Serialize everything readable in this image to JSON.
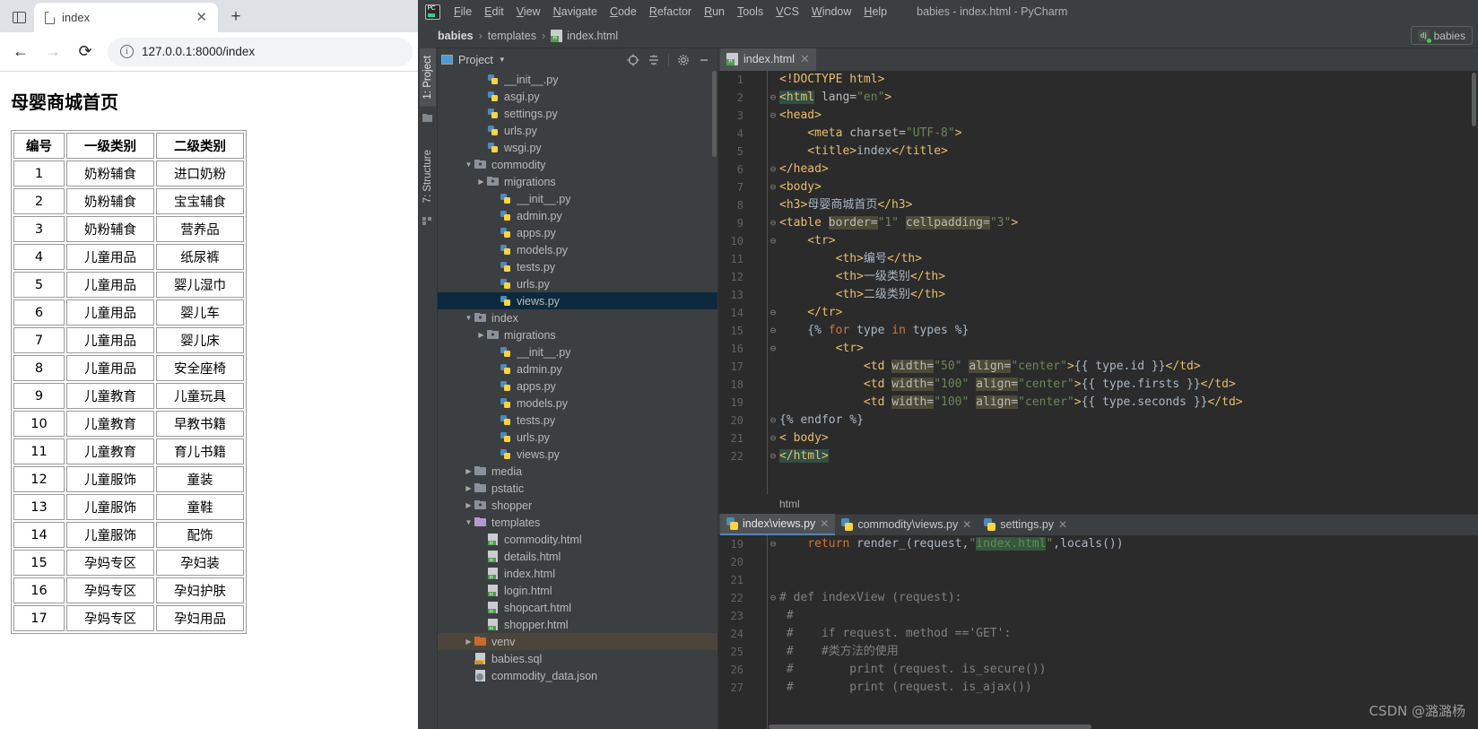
{
  "browser": {
    "tab": {
      "title": "index",
      "close_label": "✕"
    },
    "new_tab_label": "+",
    "nav": {
      "back": "←",
      "forward": "→",
      "reload": "⟳",
      "info": "i"
    },
    "address": "127.0.0.1:8000/index",
    "page": {
      "heading": "母婴商城首页",
      "table": {
        "headers": [
          "编号",
          "一级类别",
          "二级类别"
        ],
        "rows": [
          [
            "1",
            "奶粉辅食",
            "进口奶粉"
          ],
          [
            "2",
            "奶粉辅食",
            "宝宝辅食"
          ],
          [
            "3",
            "奶粉辅食",
            "营养品"
          ],
          [
            "4",
            "儿童用品",
            "纸尿裤"
          ],
          [
            "5",
            "儿童用品",
            "婴儿湿巾"
          ],
          [
            "6",
            "儿童用品",
            "婴儿车"
          ],
          [
            "7",
            "儿童用品",
            "婴儿床"
          ],
          [
            "8",
            "儿童用品",
            "安全座椅"
          ],
          [
            "9",
            "儿童教育",
            "儿童玩具"
          ],
          [
            "10",
            "儿童教育",
            "早教书籍"
          ],
          [
            "11",
            "儿童教育",
            "育儿书籍"
          ],
          [
            "12",
            "儿童服饰",
            "童装"
          ],
          [
            "13",
            "儿童服饰",
            "童鞋"
          ],
          [
            "14",
            "儿童服饰",
            "配饰"
          ],
          [
            "15",
            "孕妈专区",
            "孕妇装"
          ],
          [
            "16",
            "孕妈专区",
            "孕妇护肤"
          ],
          [
            "17",
            "孕妈专区",
            "孕妇用品"
          ]
        ]
      }
    }
  },
  "pycharm": {
    "menu": [
      "File",
      "Edit",
      "View",
      "Navigate",
      "Code",
      "Refactor",
      "Run",
      "Tools",
      "VCS",
      "Window",
      "Help"
    ],
    "window_title": "babies - index.html - PyCharm",
    "breadcrumb": [
      "babies",
      "templates",
      "index.html"
    ],
    "run_config": "babies",
    "tool_tabs": [
      "1: Project",
      "7: Structure"
    ],
    "project": {
      "title": "Project",
      "icons": [
        "locate-icon",
        "collapse-all-icon",
        "gear-icon",
        "minimize-icon"
      ],
      "tree": [
        {
          "indent": 3,
          "label": "__init__.py",
          "icon": "python-file-icon",
          "arrow": ""
        },
        {
          "indent": 3,
          "label": "asgi.py",
          "icon": "python-file-icon",
          "arrow": ""
        },
        {
          "indent": 3,
          "label": "settings.py",
          "icon": "python-file-icon",
          "arrow": ""
        },
        {
          "indent": 3,
          "label": "urls.py",
          "icon": "python-file-icon",
          "arrow": ""
        },
        {
          "indent": 3,
          "label": "wsgi.py",
          "icon": "python-file-icon",
          "arrow": ""
        },
        {
          "indent": 2,
          "label": "commodity",
          "icon": "module-folder-icon",
          "arrow": "▼"
        },
        {
          "indent": 3,
          "label": "migrations",
          "icon": "module-folder-icon",
          "arrow": "▶"
        },
        {
          "indent": 4,
          "label": "__init__.py",
          "icon": "python-file-icon",
          "arrow": ""
        },
        {
          "indent": 4,
          "label": "admin.py",
          "icon": "python-file-icon",
          "arrow": ""
        },
        {
          "indent": 4,
          "label": "apps.py",
          "icon": "python-file-icon",
          "arrow": ""
        },
        {
          "indent": 4,
          "label": "models.py",
          "icon": "python-file-icon",
          "arrow": ""
        },
        {
          "indent": 4,
          "label": "tests.py",
          "icon": "python-file-icon",
          "arrow": ""
        },
        {
          "indent": 4,
          "label": "urls.py",
          "icon": "python-file-icon",
          "arrow": ""
        },
        {
          "indent": 4,
          "label": "views.py",
          "icon": "python-file-icon",
          "arrow": "",
          "state": "selected"
        },
        {
          "indent": 2,
          "label": "index",
          "icon": "module-folder-icon",
          "arrow": "▼"
        },
        {
          "indent": 3,
          "label": "migrations",
          "icon": "module-folder-icon",
          "arrow": "▶"
        },
        {
          "indent": 4,
          "label": "__init__.py",
          "icon": "python-file-icon",
          "arrow": ""
        },
        {
          "indent": 4,
          "label": "admin.py",
          "icon": "python-file-icon",
          "arrow": ""
        },
        {
          "indent": 4,
          "label": "apps.py",
          "icon": "python-file-icon",
          "arrow": ""
        },
        {
          "indent": 4,
          "label": "models.py",
          "icon": "python-file-icon",
          "arrow": ""
        },
        {
          "indent": 4,
          "label": "tests.py",
          "icon": "python-file-icon",
          "arrow": ""
        },
        {
          "indent": 4,
          "label": "urls.py",
          "icon": "python-file-icon",
          "arrow": ""
        },
        {
          "indent": 4,
          "label": "views.py",
          "icon": "python-file-icon",
          "arrow": ""
        },
        {
          "indent": 2,
          "label": "media",
          "icon": "folder-icon",
          "arrow": "▶"
        },
        {
          "indent": 2,
          "label": "pstatic",
          "icon": "folder-icon",
          "arrow": "▶"
        },
        {
          "indent": 2,
          "label": "shopper",
          "icon": "module-folder-icon",
          "arrow": "▶"
        },
        {
          "indent": 2,
          "label": "templates",
          "icon": "templates-folder-icon",
          "arrow": "▼"
        },
        {
          "indent": 3,
          "label": "commodity.html",
          "icon": "html-file-icon",
          "arrow": ""
        },
        {
          "indent": 3,
          "label": "details.html",
          "icon": "html-file-icon",
          "arrow": ""
        },
        {
          "indent": 3,
          "label": "index.html",
          "icon": "html-file-icon",
          "arrow": ""
        },
        {
          "indent": 3,
          "label": "login.html",
          "icon": "html-file-icon",
          "arrow": ""
        },
        {
          "indent": 3,
          "label": "shopcart.html",
          "icon": "html-file-icon",
          "arrow": ""
        },
        {
          "indent": 3,
          "label": "shopper.html",
          "icon": "html-file-icon",
          "arrow": ""
        },
        {
          "indent": 2,
          "label": "venv",
          "icon": "venv-folder-icon",
          "arrow": "▶",
          "state": "highlighted"
        },
        {
          "indent": 2,
          "label": "babies.sql",
          "icon": "sql-file-icon",
          "arrow": ""
        },
        {
          "indent": 2,
          "label": "commodity_data.json",
          "icon": "json-file-icon",
          "arrow": ""
        }
      ]
    },
    "editor": {
      "tab": {
        "label": "index.html",
        "close": "✕"
      },
      "breadcrumb": "html",
      "lines": [
        {
          "n": "1",
          "indent": 0,
          "fold": "",
          "parts": [
            {
              "t": "<!DOCTYPE html>",
              "c": "tag"
            }
          ]
        },
        {
          "n": "2",
          "indent": 0,
          "fold": "⊖",
          "parts": [
            {
              "t": "<html",
              "c": "tag hlteal"
            },
            {
              "t": " lang=",
              "c": "attr"
            },
            {
              "t": "\"en\"",
              "c": "val"
            },
            {
              "t": ">",
              "c": "tag"
            }
          ]
        },
        {
          "n": "3",
          "indent": 0,
          "fold": "⊖",
          "parts": [
            {
              "t": "<head>",
              "c": "tag"
            }
          ]
        },
        {
          "n": "4",
          "indent": 0,
          "fold": "",
          "parts": [
            {
              "t": "    <meta ",
              "c": "tag"
            },
            {
              "t": "charset=",
              "c": "attr"
            },
            {
              "t": "\"UTF-8\"",
              "c": "val"
            },
            {
              "t": ">",
              "c": "tag"
            }
          ]
        },
        {
          "n": "5",
          "indent": 0,
          "fold": "",
          "parts": [
            {
              "t": "    <title>",
              "c": "tag"
            },
            {
              "t": "index",
              "c": "txt"
            },
            {
              "t": "</title>",
              "c": "tag"
            }
          ]
        },
        {
          "n": "6",
          "indent": 0,
          "fold": "⊖",
          "parts": [
            {
              "t": "</head>",
              "c": "tag"
            }
          ]
        },
        {
          "n": "7",
          "indent": 0,
          "fold": "⊖",
          "parts": [
            {
              "t": "<body>",
              "c": "tag"
            }
          ]
        },
        {
          "n": "8",
          "indent": 0,
          "fold": "",
          "parts": [
            {
              "t": "<h3>",
              "c": "tag"
            },
            {
              "t": "母婴商城首页",
              "c": "txt"
            },
            {
              "t": "</h3>",
              "c": "tag"
            }
          ]
        },
        {
          "n": "9",
          "indent": 0,
          "fold": "⊖",
          "parts": [
            {
              "t": "<table ",
              "c": "tag"
            },
            {
              "t": "border=",
              "c": "attr hl"
            },
            {
              "t": "\"1\"",
              "c": "val"
            },
            {
              "t": " ",
              "c": "txt"
            },
            {
              "t": "cellpadding=",
              "c": "attr hl"
            },
            {
              "t": "\"3\"",
              "c": "val"
            },
            {
              "t": ">",
              "c": "tag"
            }
          ]
        },
        {
          "n": "10",
          "indent": 0,
          "fold": "⊖",
          "parts": [
            {
              "t": "    <tr>",
              "c": "tag"
            }
          ]
        },
        {
          "n": "11",
          "indent": 0,
          "fold": "",
          "parts": [
            {
              "t": "        <th>",
              "c": "tag"
            },
            {
              "t": "编号",
              "c": "txt"
            },
            {
              "t": "</th>",
              "c": "tag"
            }
          ]
        },
        {
          "n": "12",
          "indent": 0,
          "fold": "",
          "parts": [
            {
              "t": "        <th>",
              "c": "tag"
            },
            {
              "t": "一级类别",
              "c": "txt"
            },
            {
              "t": "</th>",
              "c": "tag"
            }
          ]
        },
        {
          "n": "13",
          "indent": 0,
          "fold": "",
          "parts": [
            {
              "t": "        <th>",
              "c": "tag"
            },
            {
              "t": "二级类别",
              "c": "txt"
            },
            {
              "t": "</th>",
              "c": "tag"
            }
          ]
        },
        {
          "n": "14",
          "indent": 0,
          "fold": "⊖",
          "parts": [
            {
              "t": "    </tr>",
              "c": "tag"
            }
          ]
        },
        {
          "n": "15",
          "indent": 0,
          "fold": "⊖",
          "parts": [
            {
              "t": "    {% ",
              "c": "txt"
            },
            {
              "t": "for",
              "c": "kw"
            },
            {
              "t": " type ",
              "c": "txt"
            },
            {
              "t": "in",
              "c": "kw"
            },
            {
              "t": " types %}",
              "c": "txt"
            }
          ]
        },
        {
          "n": "16",
          "indent": 0,
          "fold": "⊖",
          "parts": [
            {
              "t": "        <tr>",
              "c": "tag"
            }
          ]
        },
        {
          "n": "17",
          "indent": 0,
          "fold": "",
          "parts": [
            {
              "t": "            <td ",
              "c": "tag"
            },
            {
              "t": "width=",
              "c": "attr hl"
            },
            {
              "t": "\"50\"",
              "c": "val"
            },
            {
              "t": " ",
              "c": "txt"
            },
            {
              "t": "align=",
              "c": "attr hl"
            },
            {
              "t": "\"center\"",
              "c": "val"
            },
            {
              "t": ">",
              "c": "tag"
            },
            {
              "t": "{{ type.id }}",
              "c": "txt"
            },
            {
              "t": "</td>",
              "c": "tag"
            }
          ]
        },
        {
          "n": "18",
          "indent": 0,
          "fold": "",
          "parts": [
            {
              "t": "            <td ",
              "c": "tag"
            },
            {
              "t": "width=",
              "c": "attr hl"
            },
            {
              "t": "\"100\"",
              "c": "val"
            },
            {
              "t": " ",
              "c": "txt"
            },
            {
              "t": "align=",
              "c": "attr hl"
            },
            {
              "t": "\"center\"",
              "c": "val"
            },
            {
              "t": ">",
              "c": "tag"
            },
            {
              "t": "{{ type.firsts }}",
              "c": "txt"
            },
            {
              "t": "</td>",
              "c": "tag"
            }
          ]
        },
        {
          "n": "19",
          "indent": 0,
          "fold": "",
          "parts": [
            {
              "t": "            <td ",
              "c": "tag"
            },
            {
              "t": "width=",
              "c": "attr hl"
            },
            {
              "t": "\"100\"",
              "c": "val"
            },
            {
              "t": " ",
              "c": "txt"
            },
            {
              "t": "align=",
              "c": "attr hl"
            },
            {
              "t": "\"center\"",
              "c": "val"
            },
            {
              "t": ">",
              "c": "tag"
            },
            {
              "t": "{{ type.seconds }}",
              "c": "txt"
            },
            {
              "t": "</td>",
              "c": "tag"
            }
          ]
        },
        {
          "n": "20",
          "indent": 0,
          "fold": "⊖",
          "parts": [
            {
              "t": "{% endfor %}",
              "c": "txt"
            }
          ]
        },
        {
          "n": "21",
          "indent": 0,
          "fold": "⊖",
          "parts": [
            {
              "t": "< body>",
              "c": "tag"
            }
          ]
        },
        {
          "n": "22",
          "indent": 0,
          "fold": "⊖",
          "parts": [
            {
              "t": "</html>",
              "c": "tag hlteal"
            }
          ]
        }
      ]
    },
    "split": {
      "tabs": [
        {
          "label": "index\\views.py",
          "close": "✕",
          "active": true
        },
        {
          "label": "commodity\\views.py",
          "close": "✕",
          "active": false
        },
        {
          "label": "settings.py",
          "close": "✕",
          "active": false
        }
      ],
      "lines": [
        {
          "n": "19",
          "fold": "⊖",
          "parts": [
            {
              "t": "    ",
              "c": "txt"
            },
            {
              "t": "return",
              "c": "kw"
            },
            {
              "t": " render",
              "c": "txt"
            },
            {
              "t": "_(request",
              "c": "txt"
            },
            {
              "t": ",",
              "c": "txt"
            },
            {
              "t": "\"",
              "c": "val"
            },
            {
              "t": "index.html",
              "c": "val hlgreen"
            },
            {
              "t": "\"",
              "c": "val"
            },
            {
              "t": ",locals())",
              "c": "txt"
            }
          ]
        },
        {
          "n": "20",
          "fold": "",
          "parts": []
        },
        {
          "n": "21",
          "fold": "",
          "parts": []
        },
        {
          "n": "22",
          "fold": "⊖",
          "parts": [
            {
              "t": "# def indexView (request):",
              "c": "cmt"
            }
          ]
        },
        {
          "n": "23",
          "fold": "",
          "parts": [
            {
              "t": " #",
              "c": "cmt"
            }
          ]
        },
        {
          "n": "24",
          "fold": "",
          "parts": [
            {
              "t": " #    if request. method ==",
              "c": "cmt"
            },
            {
              "t": "'GET'",
              "c": "cmt"
            },
            {
              "t": ":",
              "c": "cmt"
            }
          ]
        },
        {
          "n": "25",
          "fold": "",
          "parts": [
            {
              "t": " #    #类方法的使用",
              "c": "cmt"
            }
          ]
        },
        {
          "n": "26",
          "fold": "",
          "parts": [
            {
              "t": " #        print (request. is_secure())",
              "c": "cmt"
            }
          ]
        },
        {
          "n": "27",
          "fold": "",
          "parts": [
            {
              "t": " #        print (request. is_ajax())",
              "c": "cmt"
            }
          ]
        }
      ]
    },
    "watermark": "CSDN @潞潞杨"
  }
}
